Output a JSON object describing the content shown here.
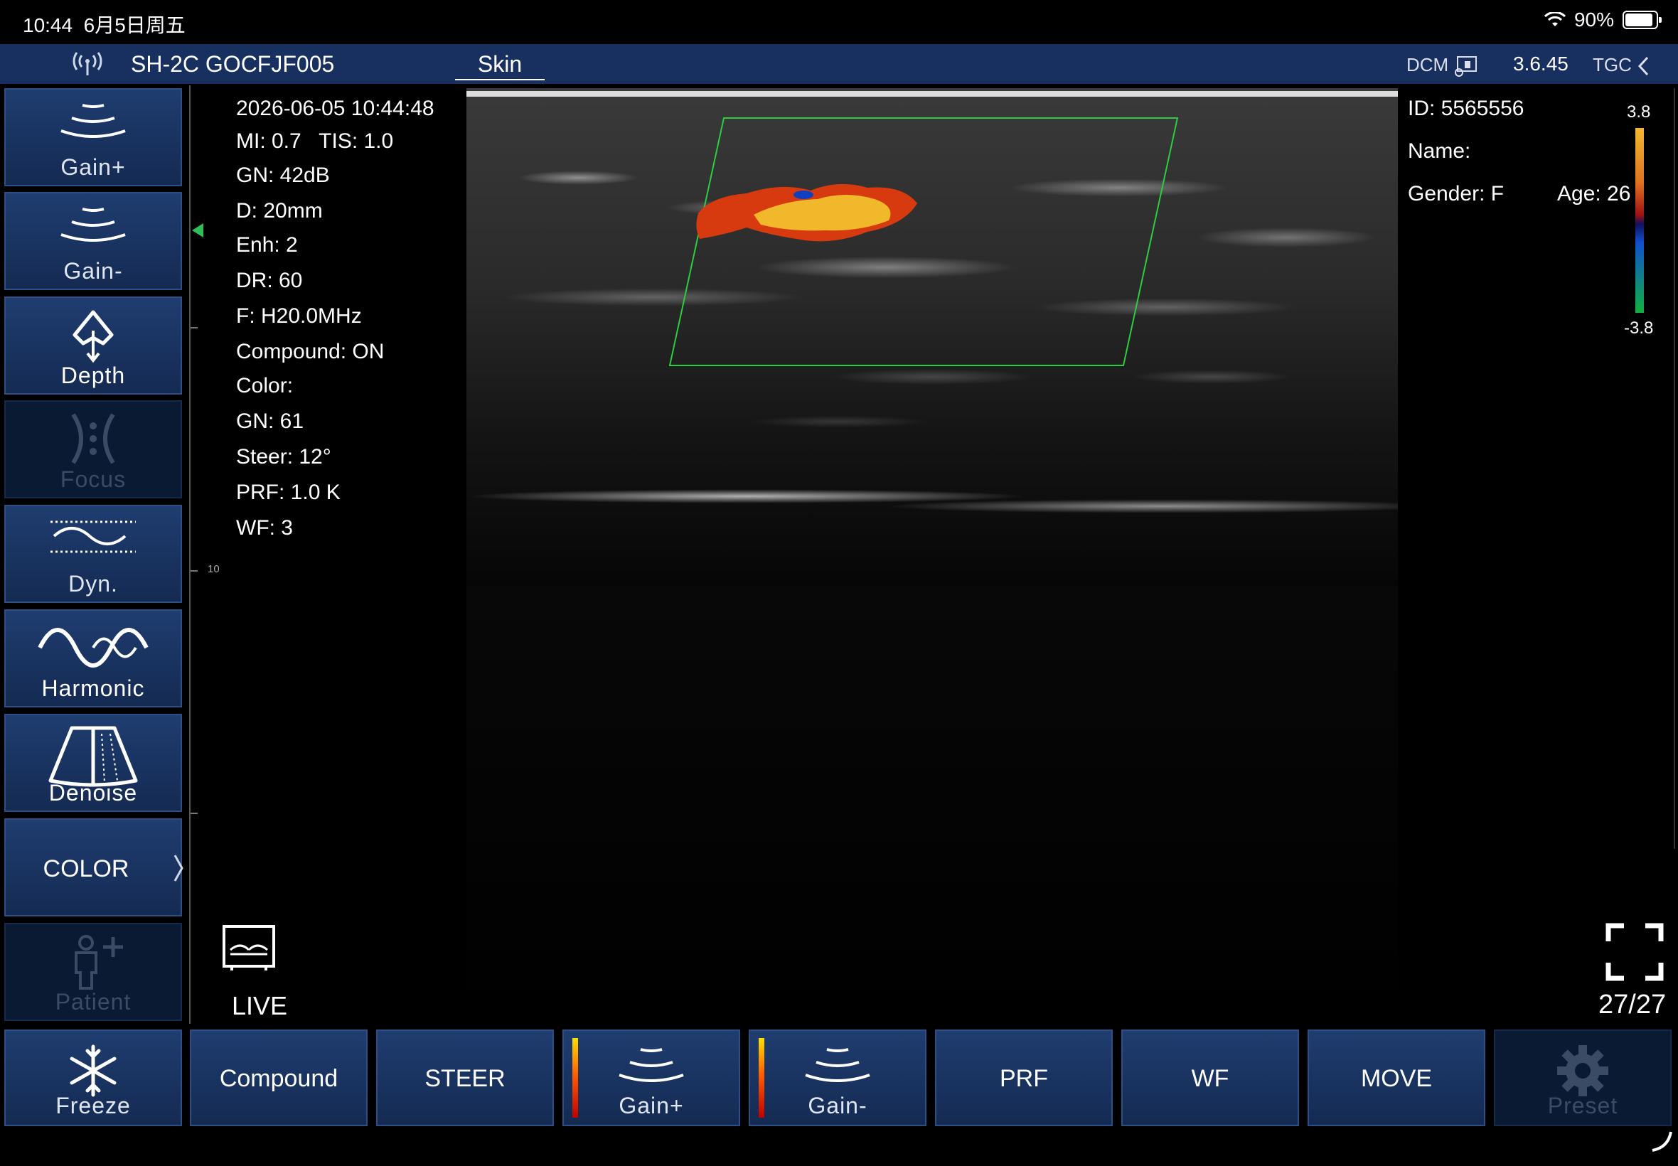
{
  "status_bar": {
    "time": "10:44",
    "date": "6月5日周五",
    "battery": "90%",
    "battery_level": 0.9
  },
  "top_bar": {
    "device": "SH-2C GOCFJF005",
    "mode": "Skin",
    "dcm": "DCM",
    "version": "3.6.45",
    "tgc": "TGC"
  },
  "left_buttons": [
    {
      "label": "Gain+",
      "icon": "gain-plus-icon"
    },
    {
      "label": "Gain-",
      "icon": "gain-minus-icon"
    },
    {
      "label": "Depth",
      "icon": "depth-icon"
    },
    {
      "label": "Focus",
      "icon": "focus-icon",
      "disabled": true
    },
    {
      "label": "Dyn.",
      "icon": "dynamic-range-icon"
    },
    {
      "label": "Harmonic",
      "icon": "harmonic-wave-icon"
    },
    {
      "label": "Denoise",
      "icon": "denoise-icon"
    },
    {
      "label": "COLOR",
      "icon": "chevron-right-icon"
    },
    {
      "label": "Patient",
      "icon": "patient-add-icon",
      "disabled": true
    }
  ],
  "bottom_buttons": [
    {
      "label": "Freeze",
      "icon": "snowflake-icon"
    },
    {
      "label": "Compound"
    },
    {
      "label": "STEER"
    },
    {
      "label": "Gain+",
      "icon": "gain-plus-icon"
    },
    {
      "label": "Gain-",
      "icon": "gain-minus-icon"
    },
    {
      "label": "PRF"
    },
    {
      "label": "WF"
    },
    {
      "label": "MOVE"
    },
    {
      "label": "Preset",
      "icon": "gear-icon",
      "disabled": true
    }
  ],
  "info": {
    "datetime": "2026-06-05 10:44:48",
    "mi_tis": "MI: 0.7   TIS: 1.0",
    "gn": "GN: 42dB",
    "depth": "D: 20mm",
    "enh": "Enh: 2",
    "dr": "DR: 60",
    "freq": "F: H20.0MHz",
    "compound": "Compound: ON",
    "color": "Color:",
    "color_gn": "GN: 61",
    "steer": "Steer: 12°",
    "prf": "PRF: 1.0 K",
    "wf": "WF: 3"
  },
  "patient": {
    "id": "ID: 5565556",
    "name": "Name:",
    "gender": "Gender: F",
    "age": "Age: 26"
  },
  "color_scale": {
    "max": "3.8",
    "min": "-3.8"
  },
  "depth_tick_label": "10",
  "live_label": "LIVE",
  "frame_counter": "27/27",
  "colors": {
    "button_bg": "#1a3566",
    "top_bar_bg": "#18305f",
    "roi_box": "#2ecc40"
  }
}
